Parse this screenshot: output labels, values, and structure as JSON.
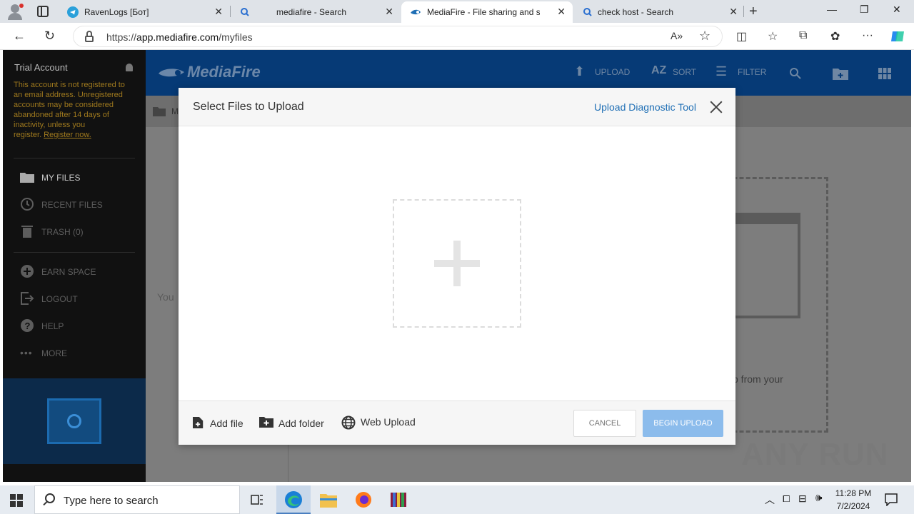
{
  "browser": {
    "tabs": [
      {
        "label": "RavenLogs [Бот]",
        "icon": "telegram-icon"
      },
      {
        "label": "mediafire - Search",
        "icon": "search-icon"
      },
      {
        "label": "MediaFire - File sharing and storage",
        "icon": "mediafire-icon",
        "active": true
      },
      {
        "label": "check host - Search",
        "icon": "search-icon"
      }
    ],
    "url_prefix": "https://",
    "url_domain": "app.mediafire.com",
    "url_path": "/myfiles"
  },
  "sidebar": {
    "account_title": "Trial Account",
    "trial_message": "This account is not registered to an email address. Unregistered accounts may be considered abandoned after 14 days of inactivity, unless you register.",
    "register_link": "Register now.",
    "items": [
      {
        "label": "MY FILES",
        "icon": "folder-icon"
      },
      {
        "label": "RECENT FILES",
        "icon": "clock-icon"
      },
      {
        "label": "TRASH (0)",
        "icon": "trash-icon"
      },
      {
        "label": "EARN SPACE",
        "icon": "plus-circle-icon"
      },
      {
        "label": "LOGOUT",
        "icon": "logout-icon"
      },
      {
        "label": "HELP",
        "icon": "help-icon"
      },
      {
        "label": "MORE",
        "icon": "more-icon"
      }
    ]
  },
  "header": {
    "logo": "MediaFire",
    "upload": "UPLOAD",
    "sort": "SORT",
    "filter": "FILTER"
  },
  "background": {
    "crumb": "My",
    "left_text": "You",
    "right_text": "p from your"
  },
  "modal": {
    "title": "Select Files to Upload",
    "diagnostic_link": "Upload Diagnostic Tool",
    "add_file": "Add file",
    "add_folder": "Add folder",
    "web_upload": "Web Upload",
    "cancel": "CANCEL",
    "begin_upload": "BEGIN UPLOAD"
  },
  "watermark": "ANY RUN",
  "taskbar": {
    "search_placeholder": "Type here to search",
    "time": "11:28 PM",
    "date": "7/2/2024"
  },
  "colors": {
    "header_blue": "#063a76",
    "link_blue": "#1f6fb5",
    "begin_button": "#8cbcec",
    "trial_warning": "#a07a1e"
  }
}
